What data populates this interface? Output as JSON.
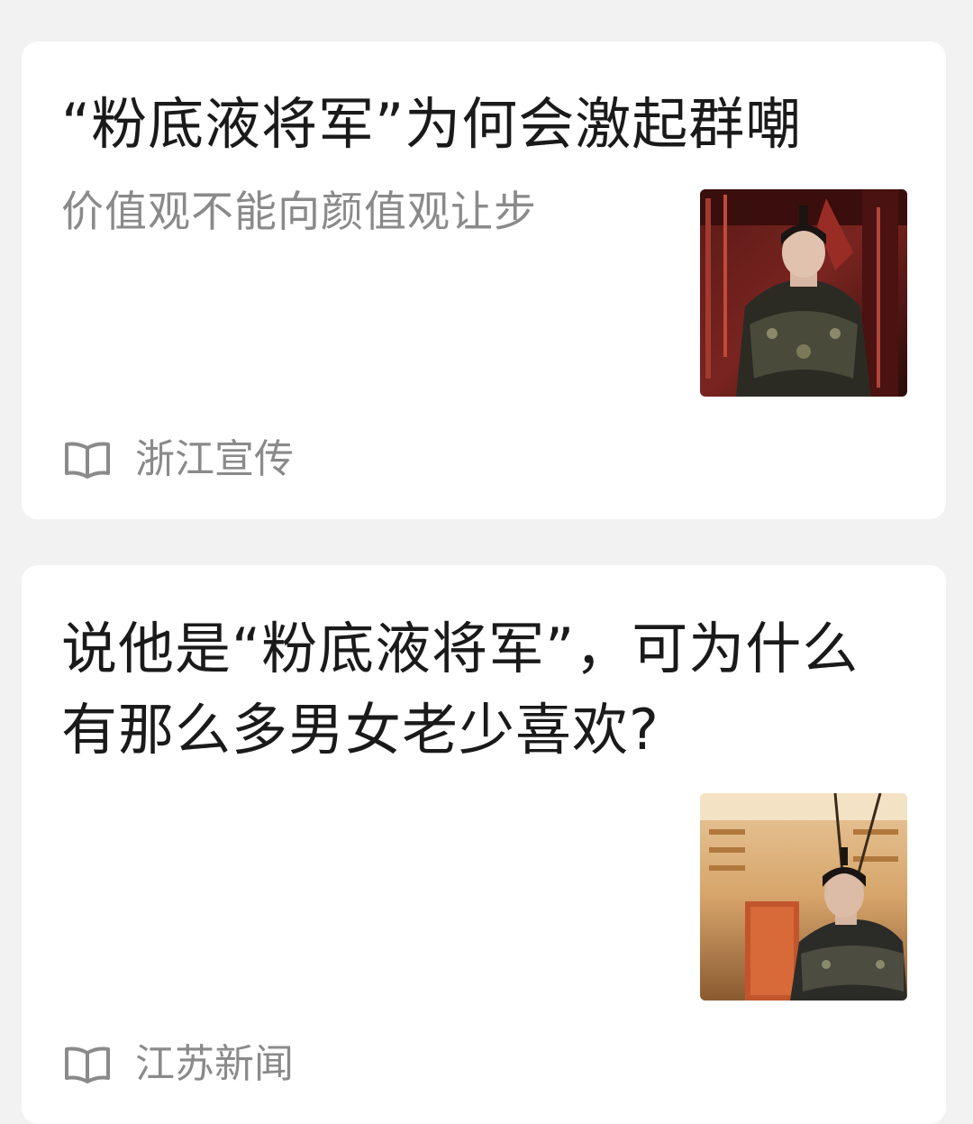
{
  "feed": {
    "articles": [
      {
        "title": "“粉底液将军”为何会激起群嘲",
        "subtitle": "价值观不能向颜值观让步",
        "source": "浙江宣传",
        "source_icon": "book-icon",
        "thumbnail": "general-in-armor-red-hall"
      },
      {
        "title": "说他是“粉底液将军”，可为什么有那么多男女老少喜欢?",
        "source": "江苏新闻",
        "source_icon": "book-icon",
        "thumbnail": "general-in-armor-golden-hall"
      }
    ]
  },
  "colors": {
    "background": "#f2f2f2",
    "card": "#ffffff",
    "title": "#1a1a1a",
    "secondary": "#8a8a8a"
  }
}
